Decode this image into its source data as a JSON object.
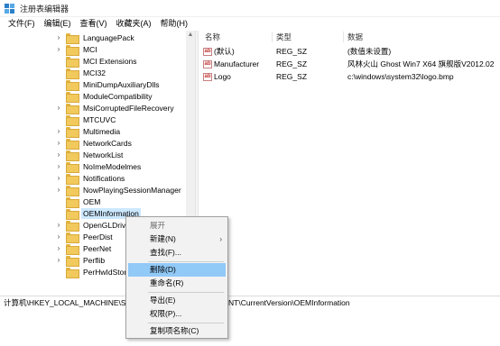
{
  "window": {
    "title": "注册表编辑器"
  },
  "menubar": {
    "items": [
      "文件(F)",
      "编辑(E)",
      "查看(V)",
      "收藏夹(A)",
      "帮助(H)"
    ]
  },
  "tree": {
    "items": [
      {
        "label": "LanguagePack",
        "expander": "›"
      },
      {
        "label": "MCI",
        "expander": "›"
      },
      {
        "label": "MCI Extensions",
        "expander": ""
      },
      {
        "label": "MCI32",
        "expander": ""
      },
      {
        "label": "MiniDumpAuxiliaryDlls",
        "expander": ""
      },
      {
        "label": "ModuleCompatibility",
        "expander": ""
      },
      {
        "label": "MsiCorruptedFileRecovery",
        "expander": "›"
      },
      {
        "label": "MTCUVC",
        "expander": ""
      },
      {
        "label": "Multimedia",
        "expander": "›"
      },
      {
        "label": "NetworkCards",
        "expander": "›"
      },
      {
        "label": "NetworkList",
        "expander": "›"
      },
      {
        "label": "NoImeModelmes",
        "expander": "›"
      },
      {
        "label": "Notifications",
        "expander": "›"
      },
      {
        "label": "NowPlayingSessionManager",
        "expander": "›"
      },
      {
        "label": "OEM",
        "expander": ""
      },
      {
        "label": "OEMInformation",
        "expander": ""
      },
      {
        "label": "OpenGLDrivers",
        "expander": "›"
      },
      {
        "label": "PeerDist",
        "expander": "›"
      },
      {
        "label": "PeerNet",
        "expander": "›"
      },
      {
        "label": "Perflib",
        "expander": "›"
      },
      {
        "label": "PerHwIdStorag",
        "expander": ""
      }
    ],
    "selected_index": 15,
    "scroll_up": "▲",
    "scroll_down": "▼"
  },
  "list": {
    "columns": [
      "名称",
      "类型",
      "数据"
    ],
    "rows": [
      {
        "icon": "ab",
        "name": "(默认)",
        "type": "REG_SZ",
        "data": "(数值未设置)"
      },
      {
        "icon": "ab",
        "name": "Manufacturer",
        "type": "REG_SZ",
        "data": "风林火山 Ghost Win7 X64 旗舰版V2012.02"
      },
      {
        "icon": "ab",
        "name": "Logo",
        "type": "REG_SZ",
        "data": "c:\\windows\\system32\\logo.bmp"
      }
    ]
  },
  "statusbar": {
    "path_left": "计算机\\HKEY_LOCAL_MACHINE\\SOF",
    "path_right": "NT\\CurrentVersion\\OEMInformation"
  },
  "context_menu": {
    "items": {
      "expand": "展开",
      "new": "新建(N)",
      "find": "查找(F)...",
      "delete": "删除(D)",
      "rename": "重命名(R)",
      "export": "导出(E)",
      "permissions": "权限(P)...",
      "copy_key_name": "复制项名称(C)"
    },
    "submenu_arrow": "›"
  },
  "colors": {
    "selection": "#cce8ff",
    "menu_highlight": "#91c9f7",
    "folder": "#f1c95d"
  }
}
